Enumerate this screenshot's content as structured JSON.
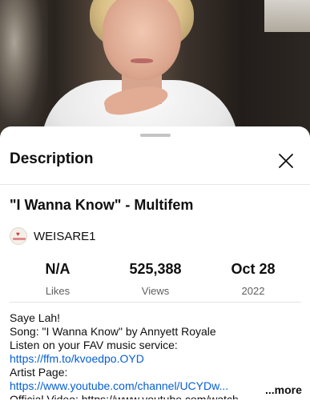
{
  "header": {
    "title": "Description"
  },
  "video": {
    "title": "\"I Wanna Know\" - Multifem",
    "channel": "WEISARE1"
  },
  "stats": {
    "likes": {
      "value": "N/A",
      "label": "Likes"
    },
    "views": {
      "value": "525,388",
      "label": "Views"
    },
    "date": {
      "value": "Oct 28",
      "label": "2022"
    }
  },
  "description": {
    "lines": [
      "Saye Lah!",
      "Song: \"I Wanna Know\" by Annyett Royale",
      "Listen on your FAV music service:",
      "https://ffm.to/kvoedpo.OYD",
      "Artist Page:",
      "https://www.youtube.com/channel/UCYDw...",
      "Official Video: https://www.youtube.com/watch..."
    ]
  },
  "more_label": "...more",
  "icons": {
    "close": "close-icon"
  },
  "colors": {
    "link": "#065fd4",
    "text": "#0f0f0f",
    "secondary": "#606060"
  }
}
